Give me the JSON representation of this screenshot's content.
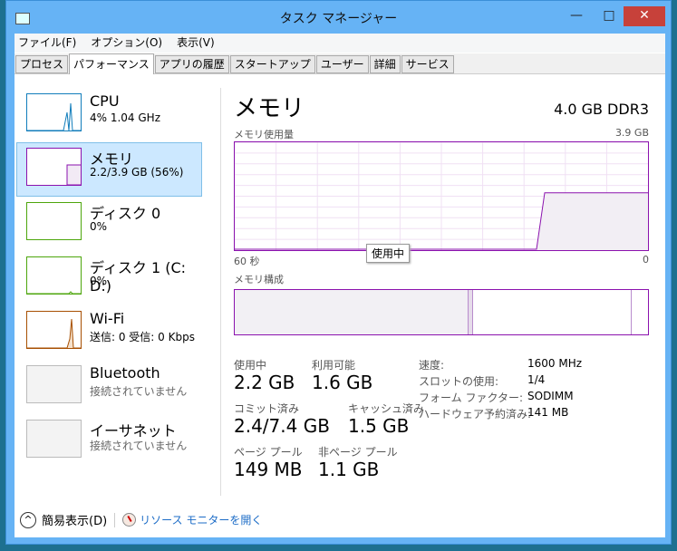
{
  "window": {
    "title": "タスク マネージャー",
    "minimize": "—",
    "maximize": "□",
    "close": "✕"
  },
  "menu": [
    "ファイル(F)",
    "オプション(O)",
    "表示(V)"
  ],
  "tabs": [
    "プロセス",
    "パフォーマンス",
    "アプリの履歴",
    "スタートアップ",
    "ユーザー",
    "詳細",
    "サービス"
  ],
  "active_tab": "パフォーマンス",
  "sidebar": [
    {
      "name": "CPU",
      "sub": "4% 1.04 GHz",
      "color": "#117dbb"
    },
    {
      "name": "メモリ",
      "sub": "2.2/3.9 GB (56%)",
      "color": "#8b12ae",
      "selected": true
    },
    {
      "name": "ディスク 0",
      "sub": "0%",
      "color": "#4da60c"
    },
    {
      "name": "ディスク 1 (C: D:)",
      "sub": "0%",
      "color": "#4da60c"
    },
    {
      "name": "Wi-Fi",
      "sub": "送信: 0 受信: 0 Kbps",
      "color": "#a74f01"
    },
    {
      "name": "Bluetooth",
      "sub": "接続されていません",
      "color": "#bbbbbb"
    },
    {
      "name": "イーサネット",
      "sub": "接続されていません",
      "color": "#bbbbbb"
    }
  ],
  "main": {
    "title": "メモリ",
    "spec": "4.0 GB DDR3",
    "usage_label": "メモリ使用量",
    "usage_max": "3.9 GB",
    "time_left": "60 秒",
    "time_right": "0",
    "tooltip": "使用中",
    "usage_percent_now": 56,
    "composition_label": "メモリ構成",
    "stats": {
      "in_use": {
        "label": "使用中",
        "value": "2.2 GB"
      },
      "available": {
        "label": "利用可能",
        "value": "1.6 GB"
      },
      "committed": {
        "label": "コミット済み",
        "value": "2.4/7.4 GB"
      },
      "cached": {
        "label": "キャッシュ済み",
        "value": "1.5 GB"
      },
      "paged": {
        "label": "ページ プール",
        "value": "149 MB"
      },
      "nonpaged": {
        "label": "非ページ プール",
        "value": "1.1 GB"
      }
    },
    "details": [
      {
        "k": "速度:",
        "v": "1600 MHz"
      },
      {
        "k": "スロットの使用:",
        "v": "1/4"
      },
      {
        "k": "フォーム ファクター:",
        "v": "SODIMM"
      },
      {
        "k": "ハードウェア予約済み:",
        "v": "141 MB"
      }
    ]
  },
  "footer": {
    "fewer": "簡易表示(D)",
    "resmon": "リソース モニターを開く"
  },
  "colors": {
    "accent": "#8b12ae",
    "link": "#1c6cc7",
    "selection": "#cce8ff"
  }
}
